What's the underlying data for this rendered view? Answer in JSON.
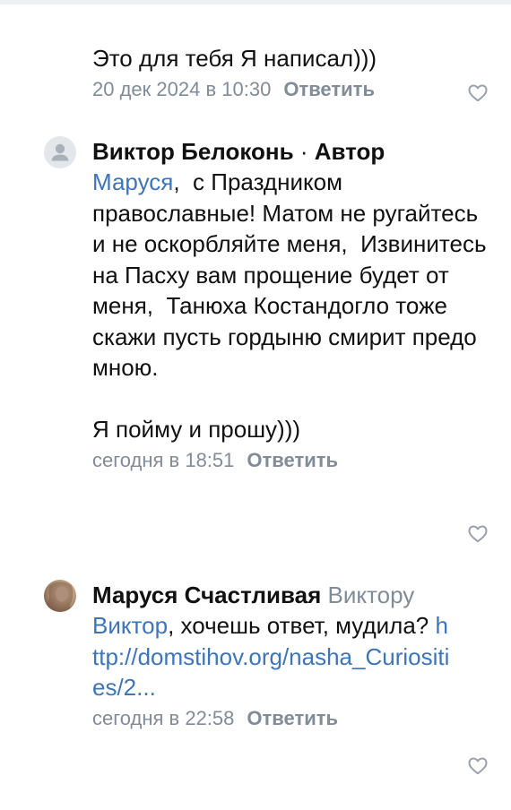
{
  "comments": [
    {
      "text": "Это для тебя Я написал)))",
      "date": "20 дек 2024 в 10:30",
      "reply_label": "Ответить"
    },
    {
      "author": "Виктор Белоконь",
      "separator": "·",
      "role": "Автор",
      "mention": "Маруся",
      "text_after_mention": ",  с Праздником православные! Матом не ругайтесь и не оскорбляйте меня,  Извинитесь на Пасху вам прощение будет от меня,  Танюха Костандогло тоже скажи пусть гордыню смирит предо мною.\n\nЯ пойму и прошу)))",
      "date": "сегодня в 18:51",
      "reply_label": "Ответить"
    },
    {
      "author": "Маруся Счастливая",
      "reply_to": "Виктору",
      "mention": "Виктор",
      "text_after_mention": ", хочешь ответ, мудила? ",
      "link": "http://domstihov.org/nasha_Curiosities/2...",
      "date": "сегодня в 22:58",
      "reply_label": "Ответить"
    }
  ],
  "icons": {
    "like": "heart-outline-icon",
    "default_avatar": "user-silhouette-icon"
  },
  "colors": {
    "link": "#3d75b8",
    "secondary": "#818c99",
    "text": "#111111"
  }
}
